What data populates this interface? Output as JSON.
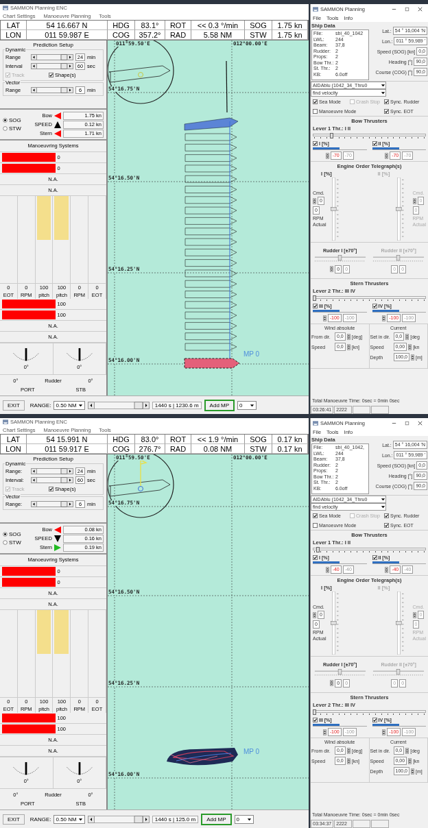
{
  "screens": [
    {
      "main": {
        "title": "SAMMON Planning ENC",
        "menu": [
          "Chart Settings",
          "Manoeuvre Planning",
          "Tools"
        ],
        "nav": [
          [
            {
              "label": "LAT",
              "value": "54 16.667 N"
            },
            {
              "label": "HDG",
              "value": "83.1°"
            },
            {
              "label": "ROT",
              "value": "<< 0.3 °/min"
            },
            {
              "label": "SOG",
              "value": "1.75 kn"
            }
          ],
          [
            {
              "label": "LON",
              "value": "011 59.987 E"
            },
            {
              "label": "COG",
              "value": "357.2°"
            },
            {
              "label": "RAD",
              "value": "5.58 NM"
            },
            {
              "label": "STW",
              "value": "1.75 kn"
            }
          ]
        ],
        "prediction": {
          "title": "Prediction Setup",
          "dynamic": "Dynamic",
          "rows": [
            {
              "label": "Range",
              "value": "24",
              "unit": "min"
            },
            {
              "label": "Interval",
              "value": "60",
              "unit": "sec"
            }
          ],
          "track": {
            "label": "Track",
            "checked": true,
            "disabled": true
          },
          "shapes": {
            "label": "Shape(s)",
            "checked": true,
            "disabled": false
          },
          "vector": "Vector",
          "vector_row": {
            "label": "Range",
            "value": "6",
            "unit": "min"
          }
        },
        "speed": {
          "modes": [
            {
              "label": "SOG",
              "selected": true
            },
            {
              "label": "STW",
              "selected": false
            }
          ],
          "rows": [
            {
              "label": "Bow",
              "kind": "left",
              "color": "#ff0000",
              "value": "1.75 kn"
            },
            {
              "label": "SPEED",
              "kind": "up",
              "color": "#000000",
              "value": "0.12 kn"
            },
            {
              "label": "Stern",
              "kind": "left",
              "color": "#ff0000",
              "value": "1.71 kn"
            }
          ]
        },
        "systems": {
          "title": "Manoeuvring Systems",
          "top_bars": [
            {
              "value": "0",
              "level": 0.5
            },
            {
              "value": "0",
              "level": 0.5
            }
          ],
          "top_na": [
            "N.A.",
            "N.A."
          ],
          "levers": [
            {
              "value": "0",
              "label": "EOT",
              "level": 0
            },
            {
              "value": "0",
              "label": "RPM",
              "level": 0
            },
            {
              "value": "100",
              "label": "pitch",
              "level": 0.5
            },
            {
              "value": "100",
              "label": "pitch",
              "level": 0.5
            },
            {
              "value": "0",
              "label": "RPM",
              "level": 0
            },
            {
              "value": "0",
              "label": "EOT",
              "level": 0
            }
          ],
          "bottom_bars": [
            {
              "value": "100",
              "level": 0.5
            },
            {
              "value": "100",
              "level": 0.5
            }
          ],
          "bottom_na": [
            "N.A.",
            "N.A."
          ],
          "dials": [
            "0°",
            "0°"
          ],
          "rudder": [
            "0°",
            "Rudder",
            "0°"
          ],
          "sides": [
            "PORT",
            "STB"
          ]
        },
        "chart": {
          "kind": "shapes",
          "lon_labels": [
            "011°59.50'E",
            "012°00.00'E"
          ],
          "lat_labels": [
            "54°16.75'N",
            "54°16.50'N",
            "54°16.25'N",
            "54°16.00'N"
          ],
          "marker": "MP 0"
        },
        "bottom": {
          "exit": "EXIT",
          "range_label": "RANGE:",
          "range": "0.50 NM",
          "readout": "1440 s | 1230.6 m",
          "add": "Add MP",
          "mp": "0"
        }
      },
      "panel": {
        "title": "SAMMON Planning",
        "menu": [
          "File",
          "Tools",
          "Info"
        ],
        "ship_data": "Ship Data",
        "ship_rows": [
          {
            "key": "File:",
            "value": "sbi_40_1042"
          },
          {
            "key": "LWL:",
            "value": "244"
          },
          {
            "key": "Beam:",
            "value": "37,8"
          },
          {
            "key": "Rudder:",
            "value": "2"
          },
          {
            "key": "Props:",
            "value": "2"
          },
          {
            "key": "Bow Thr.:",
            "value": "2"
          },
          {
            "key": "St. Thr.:",
            "value": "2"
          },
          {
            "key": "KB:",
            "value": "6.0off"
          }
        ],
        "fields": [
          {
            "label": "Lat.:",
            "value": "54 ° 16,004 'N"
          },
          {
            "label": "Lon.:",
            "value": "011 ° 59,989 '"
          },
          {
            "label": "Speed (SOG) [kn]",
            "value": "0,0"
          },
          {
            "label": "Heading [°]",
            "value": "90,0"
          },
          {
            "label": "Course (COG) [°]",
            "value": "90,0"
          }
        ],
        "selects": [
          "AIDAblu (1042_34_Thru0",
          "find velocity"
        ],
        "checks": [
          {
            "label": "Sea Mode",
            "checked": true,
            "disabled": false
          },
          {
            "label": "Crash Stop",
            "checked": false,
            "disabled": true
          },
          {
            "label": "Sync. Rudder",
            "checked": true,
            "disabled": false
          },
          {
            "label": "Manoeuvre Mode",
            "checked": false,
            "disabled": false
          },
          {
            "label": "Sync. EOT",
            "checked": true,
            "disabled": false
          }
        ],
        "bow": {
          "title": "Bow Thrusters",
          "lever": "Lever 1 Thr.: I II",
          "level": 0.15,
          "units": [
            {
              "label": "I [%]",
              "checked": true,
              "level": 0.5,
              "set": "-70",
              "actual": "-70"
            },
            {
              "label": "II [%]",
              "checked": true,
              "level": 0.5,
              "set": "-70",
              "actual": "-70"
            }
          ]
        },
        "eot": {
          "title": "Engine Order Telegraph(s)",
          "units": [
            {
              "label": "I [%]",
              "disabled": false,
              "cmd_label": "Cmd.",
              "cmd": "0",
              "rpm": "0",
              "rpm_label": "RPM",
              "actual": "Actual"
            },
            {
              "label": "II [%]",
              "disabled": true,
              "cmd_label": "Cmd.",
              "cmd": "0",
              "rpm": "0",
              "rpm_label": "RPM",
              "actual": "Actual"
            }
          ]
        },
        "rudders": [
          {
            "label": "Rudder I [±70°]",
            "disabled": false,
            "set": "0",
            "actual": "0"
          },
          {
            "label": "Rudder II [±70°]",
            "disabled": true,
            "set": "0",
            "actual": "0"
          }
        ],
        "stern": {
          "title": "Stern Thrusters",
          "lever": "Lever 2 Thr.: III IV",
          "level": 0,
          "units": [
            {
              "label": "III [%]",
              "checked": true,
              "level": 0.5,
              "set": "-100",
              "actual": "-100"
            },
            {
              "label": "IV [%]",
              "checked": true,
              "level": 0.5,
              "set": "-100",
              "actual": "-100"
            }
          ]
        },
        "wind": {
          "title": "Wind absolute",
          "rows": [
            {
              "label": "From dir.",
              "value": "0,0",
              "unit": "[deg]"
            },
            {
              "label": "Speed",
              "value": "0,0",
              "unit": "[kn]"
            }
          ]
        },
        "current": {
          "title": "Current",
          "rows": [
            {
              "label": "Set in dir.",
              "value": "0,0",
              "unit": "[deg"
            },
            {
              "label": "Speed",
              "value": "0,00",
              "unit": "[kn"
            },
            {
              "label": "Depth",
              "value": "100,0",
              "unit": "[m]"
            }
          ]
        },
        "total": "Total Manoeuvre Time: 0sec = 0min 0sec",
        "status": [
          "03:26:41",
          "2222"
        ]
      }
    },
    {
      "main": {
        "title": "SAMMON Planning ENC",
        "menu": [
          "Chart Settings",
          "Manoeuvre Planning",
          "Tools"
        ],
        "nav": [
          [
            {
              "label": "LAT",
              "value": "54 15.991 N"
            },
            {
              "label": "HDG",
              "value": "83.0°"
            },
            {
              "label": "ROT",
              "value": "<< 1.9 °/min"
            },
            {
              "label": "SOG",
              "value": "0.17 kn"
            }
          ],
          [
            {
              "label": "LON",
              "value": "011 59.917 E"
            },
            {
              "label": "COG",
              "value": "276.7°"
            },
            {
              "label": "RAD",
              "value": "0.08 NM"
            },
            {
              "label": "STW",
              "value": "0.17 kn"
            }
          ]
        ],
        "prediction": {
          "title": "Prediction Setup",
          "dynamic": "Dynamic",
          "rows": [
            {
              "label": "Range:",
              "value": "24",
              "unit": "min"
            },
            {
              "label": "Interval:",
              "value": "60",
              "unit": "sec"
            }
          ],
          "track": {
            "label": "Track",
            "checked": true,
            "disabled": true
          },
          "shapes": {
            "label": "Shape(s)",
            "checked": true,
            "disabled": false
          },
          "vector": "Vector",
          "vector_row": {
            "label": "Range:",
            "value": "6",
            "unit": "min"
          }
        },
        "speed": {
          "modes": [
            {
              "label": "SOG",
              "selected": true
            },
            {
              "label": "STW",
              "selected": false
            }
          ],
          "rows": [
            {
              "label": "Bow",
              "kind": "left",
              "color": "#ff0000",
              "value": "0.08 kn"
            },
            {
              "label": "SPEED",
              "kind": "down",
              "color": "#000000",
              "value": "0.16 kn"
            },
            {
              "label": "Stern",
              "kind": "right",
              "color": "#22bb22",
              "value": "0.19 kn"
            }
          ]
        },
        "systems": {
          "title": "Manoeuvring Systems",
          "top_bars": [
            {
              "value": "0",
              "level": 0.5
            },
            {
              "value": "0",
              "level": 0.5
            }
          ],
          "top_na": [
            "N.A.",
            "N.A."
          ],
          "levers": [
            {
              "value": "0",
              "label": "EOT",
              "level": 0
            },
            {
              "value": "0",
              "label": "RPM",
              "level": 0
            },
            {
              "value": "100",
              "label": "pitch",
              "level": 0.5
            },
            {
              "value": "100",
              "label": "pitch",
              "level": 0.5
            },
            {
              "value": "0",
              "label": "RPM",
              "level": 0
            },
            {
              "value": "0",
              "label": "EOT",
              "level": 0
            }
          ],
          "bottom_bars": [
            {
              "value": "100",
              "level": 0.5
            },
            {
              "value": "100",
              "level": 0.5
            }
          ],
          "bottom_na": [
            "N.A.",
            "N.A."
          ],
          "dials": [
            "0°",
            "0°"
          ],
          "rudder": [
            "0°",
            "Rudder",
            "0°"
          ],
          "sides": [
            "PORT",
            "STB"
          ]
        },
        "chart": {
          "kind": "cluster",
          "lon_labels": [
            "011°59.50'E",
            "012°00.00'E"
          ],
          "lat_labels": [
            "54°16.75'N",
            "54°16.50'N",
            "54°16.25'N",
            "54°16.00'N"
          ],
          "marker": "MP 0"
        },
        "bottom": {
          "exit": "EXIT",
          "range_label": "RANGE:",
          "range": "0.50 NM",
          "readout": "1440 s | 125.0 m",
          "add": "Add MP",
          "mp": "0"
        }
      },
      "panel": {
        "title": "SAMMON Planning",
        "menu": [
          "File",
          "Tools",
          "Info"
        ],
        "ship_data": "Ship Data",
        "ship_rows": [
          {
            "key": "File:",
            "value": "sbi_40_1042,"
          },
          {
            "key": "LWL:",
            "value": "244"
          },
          {
            "key": "Beam:",
            "value": "37,8"
          },
          {
            "key": "Rudder:",
            "value": "2"
          },
          {
            "key": "Props:",
            "value": "2"
          },
          {
            "key": "Bow Thr.:",
            "value": "2"
          },
          {
            "key": "St. Thr.:",
            "value": "2"
          },
          {
            "key": "KB:",
            "value": "6.0off"
          }
        ],
        "fields": [
          {
            "label": "Lat.:",
            "value": "54 ° 16,004 'N"
          },
          {
            "label": "Lon.:",
            "value": "011 ° 59,989 '"
          },
          {
            "label": "Speed (SOG) [kn]",
            "value": "0,0"
          },
          {
            "label": "Heading [°]",
            "value": "90,0"
          },
          {
            "label": "Course (COG) [°]",
            "value": "90,0"
          }
        ],
        "selects": [
          "AIDAblu (1042_34_Thru0",
          "find velocity"
        ],
        "checks": [
          {
            "label": "Sea Mode",
            "checked": true,
            "disabled": false
          },
          {
            "label": "Crash Stop",
            "checked": false,
            "disabled": true
          },
          {
            "label": "Sync. Rudder",
            "checked": true,
            "disabled": false
          },
          {
            "label": "Manoeuvre Mode",
            "checked": false,
            "disabled": false
          },
          {
            "label": "Sync. EOT",
            "checked": true,
            "disabled": false
          }
        ],
        "bow": {
          "title": "Bow Thrusters",
          "lever": "Lever 1 Thr.: I II",
          "level": 0.03,
          "units": [
            {
              "label": "I [%]",
              "checked": true,
              "level": 0.5,
              "set": "-40",
              "actual": "-40"
            },
            {
              "label": "II [%]",
              "checked": true,
              "level": 0.5,
              "set": "-40",
              "actual": "-40"
            }
          ]
        },
        "eot": {
          "title": "Engine Order Telegraph(s)",
          "units": [
            {
              "label": "I [%]",
              "disabled": false,
              "cmd_label": "Cmd.",
              "cmd": "0",
              "rpm": "0",
              "rpm_label": "RPM",
              "actual": "Actual"
            },
            {
              "label": "II [%]",
              "disabled": true,
              "cmd_label": "Cmd.",
              "cmd": "0",
              "rpm": "0",
              "rpm_label": "RPM",
              "actual": "Actual"
            }
          ]
        },
        "rudders": [
          {
            "label": "Rudder I [±70°]",
            "disabled": false,
            "set": "0",
            "actual": "0"
          },
          {
            "label": "Rudder II [±70°]",
            "disabled": true,
            "set": "0",
            "actual": "0"
          }
        ],
        "stern": {
          "title": "Stern Thrusters",
          "lever": "Lever 2 Thr.: III IV",
          "level": 0,
          "units": [
            {
              "label": "III [%]",
              "checked": true,
              "level": 0.5,
              "set": "-100",
              "actual": "-100"
            },
            {
              "label": "IV [%]",
              "checked": true,
              "level": 0.5,
              "set": "-100",
              "actual": "-100"
            }
          ]
        },
        "wind": {
          "title": "Wind absolute",
          "rows": [
            {
              "label": "From dir.",
              "value": "0,0",
              "unit": "[deg]"
            },
            {
              "label": "Speed",
              "value": "0,0",
              "unit": "[kn]"
            }
          ]
        },
        "current": {
          "title": "Current",
          "rows": [
            {
              "label": "Set in dir.",
              "value": "0,0",
              "unit": "[deg"
            },
            {
              "label": "Speed",
              "value": "0,00",
              "unit": "[kn"
            },
            {
              "label": "Depth",
              "value": "100,0",
              "unit": "[m]"
            }
          ]
        },
        "total": "Total Manoeuvre Time: 0sec = 0min 0sec",
        "status": [
          "03:34:37",
          "2222"
        ]
      }
    }
  ]
}
